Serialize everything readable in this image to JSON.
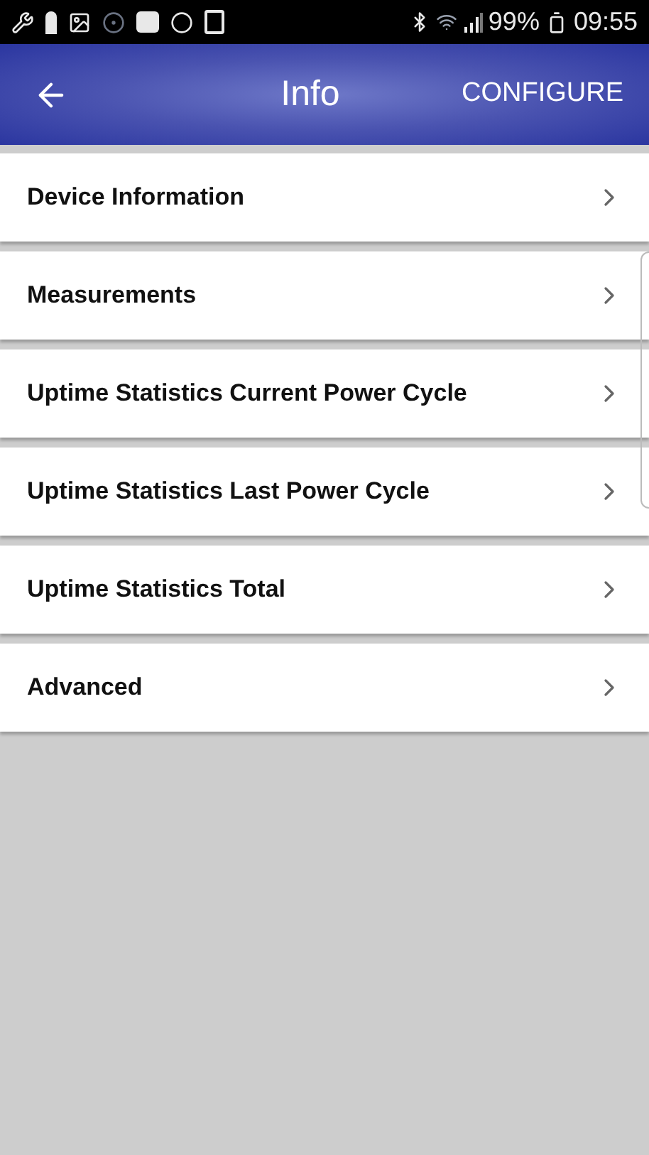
{
  "status_bar": {
    "battery": "99%",
    "time": "09:55"
  },
  "header": {
    "title": "Info",
    "action": "CONFIGURE"
  },
  "items": [
    {
      "label": "Device Information"
    },
    {
      "label": "Measurements"
    },
    {
      "label": "Uptime Statistics Current Power Cycle"
    },
    {
      "label": "Uptime Statistics Last Power Cycle"
    },
    {
      "label": "Uptime Statistics Total"
    },
    {
      "label": "Advanced"
    }
  ]
}
